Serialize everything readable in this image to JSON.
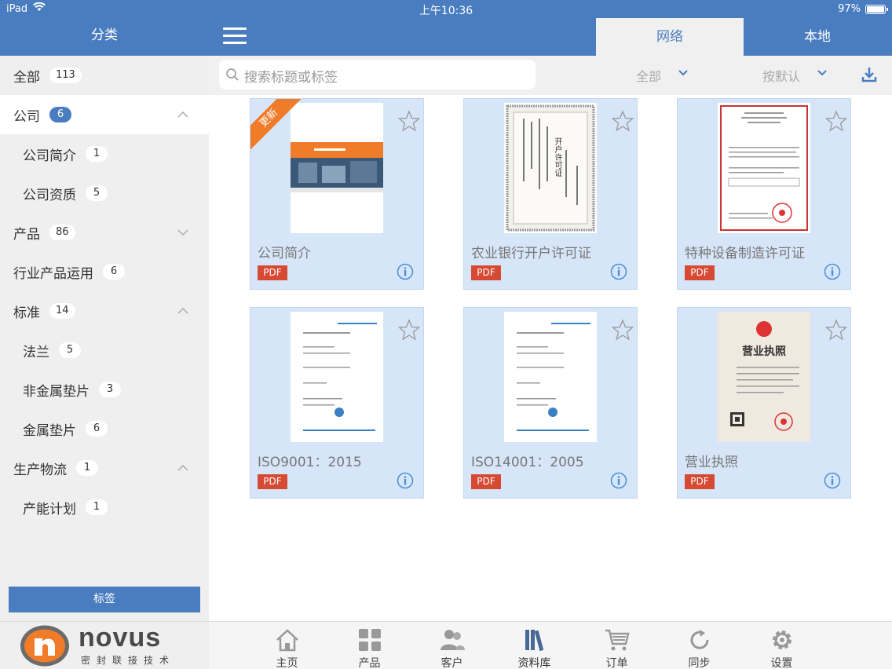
{
  "status": {
    "device": "iPad",
    "time": "上午10:36",
    "battery": "97%"
  },
  "sidebar": {
    "title": "分类",
    "items": [
      {
        "label": "全部",
        "count": "113",
        "type": "main",
        "chevron": ""
      },
      {
        "label": "公司",
        "count": "6",
        "type": "main",
        "chevron": "up",
        "active": true
      },
      {
        "label": "公司简介",
        "count": "1",
        "type": "sub",
        "chevron": ""
      },
      {
        "label": "公司资质",
        "count": "5",
        "type": "sub",
        "chevron": ""
      },
      {
        "label": "产品",
        "count": "86",
        "type": "main",
        "chevron": "down"
      },
      {
        "label": "行业产品运用",
        "count": "6",
        "type": "main",
        "chevron": ""
      },
      {
        "label": "标准",
        "count": "14",
        "type": "main",
        "chevron": "up"
      },
      {
        "label": "法兰",
        "count": "5",
        "type": "sub",
        "chevron": ""
      },
      {
        "label": "非金属垫片",
        "count": "3",
        "type": "sub",
        "chevron": ""
      },
      {
        "label": "金属垫片",
        "count": "6",
        "type": "sub",
        "chevron": ""
      },
      {
        "label": "生产物流",
        "count": "1",
        "type": "main",
        "chevron": "up"
      },
      {
        "label": "产能计划",
        "count": "1",
        "type": "sub",
        "chevron": ""
      }
    ],
    "tag_button": "标签"
  },
  "tabs": {
    "network": "网络",
    "local": "本地"
  },
  "search": {
    "placeholder": "搜索标题或标签"
  },
  "filters": {
    "category": "全部",
    "sort": "按默认"
  },
  "cards": [
    {
      "title": "公司简介",
      "type": "PDF",
      "ribbon": "更新"
    },
    {
      "title": "农业银行开户许可证",
      "type": "PDF"
    },
    {
      "title": "特种设备制造许可证",
      "type": "PDF"
    },
    {
      "title": "ISO9001：2015",
      "type": "PDF"
    },
    {
      "title": "ISO14001：2005",
      "type": "PDF"
    },
    {
      "title": "营业执照",
      "type": "PDF"
    }
  ],
  "thumb_text": {
    "license_heading": "开户许可证",
    "business_license_heading": "营业执照"
  },
  "logo": {
    "brand": "novus",
    "tagline": "密封联接技术"
  },
  "nav": [
    {
      "label": "主页",
      "icon": "home-icon"
    },
    {
      "label": "产品",
      "icon": "grid-icon"
    },
    {
      "label": "客户",
      "icon": "customers-icon"
    },
    {
      "label": "资料库",
      "icon": "library-icon",
      "active": true
    },
    {
      "label": "订单",
      "icon": "cart-icon"
    },
    {
      "label": "同步",
      "icon": "sync-icon"
    },
    {
      "label": "设置",
      "icon": "gear-icon"
    }
  ],
  "colors": {
    "header": "#4a7dc0",
    "card": "#d6e5f7",
    "pdf": "#d64a34",
    "ribbon": "#f07b28"
  }
}
